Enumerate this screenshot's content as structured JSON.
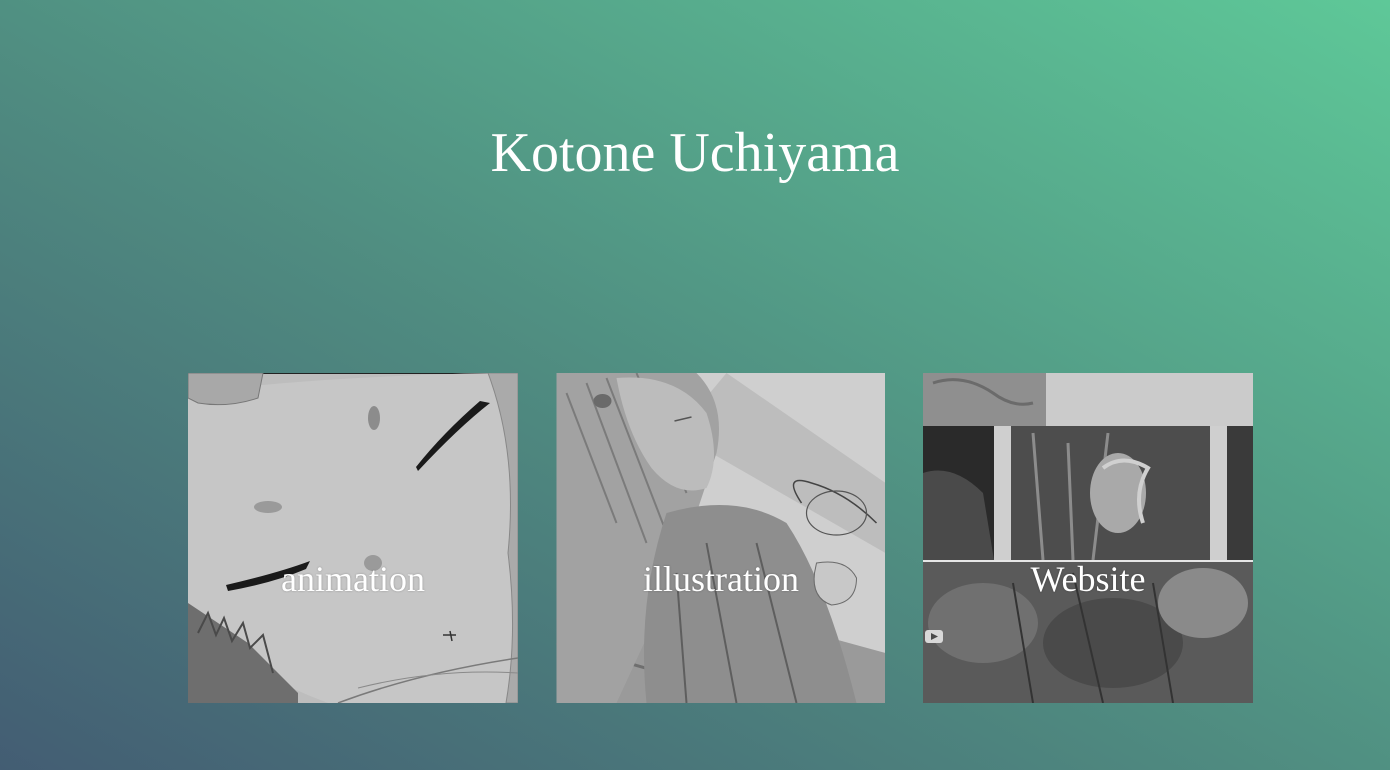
{
  "header": {
    "title": "Kotone Uchiyama"
  },
  "gallery": {
    "tiles": [
      {
        "label": "animation",
        "thumbnail_icon": "anime-girl-face-thumbnail"
      },
      {
        "label": "illustration",
        "thumbnail_icon": "girl-holding-flower-thumbnail"
      },
      {
        "label": "Website",
        "thumbnail_icon": "website-collage-thumbnail"
      }
    ]
  },
  "colors": {
    "gradient_bottom_left": "#435d73",
    "gradient_top_right": "#5ec898",
    "text": "#ffffff"
  }
}
